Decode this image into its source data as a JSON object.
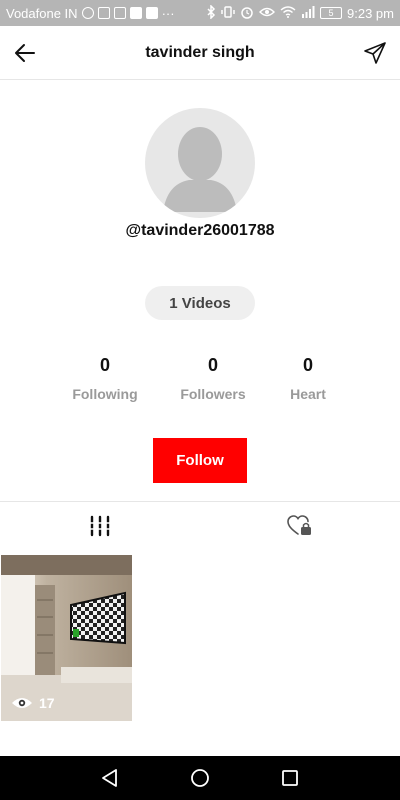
{
  "status_bar": {
    "carrier": "Vodafone IN",
    "overflow": "···",
    "battery_level": "5",
    "time": "9:23 pm",
    "icons": [
      "whatsapp-icon",
      "sim-icon",
      "app-icon",
      "app-icon",
      "facebook-icon",
      "bluetooth-icon",
      "vibrate-icon",
      "alarm-icon",
      "eye-icon",
      "wifi-icon",
      "signal-icon",
      "battery-icon"
    ]
  },
  "header": {
    "title": "tavinder singh",
    "back_icon": "back-arrow-icon",
    "share_icon": "send-icon"
  },
  "profile": {
    "username": "@tavinder26001788",
    "videos_label": "1 Videos",
    "stats": [
      {
        "value": "0",
        "label": "Following"
      },
      {
        "value": "0",
        "label": "Followers"
      },
      {
        "value": "0",
        "label": "Heart"
      }
    ],
    "follow_label": "Follow",
    "follow_color": "#ff0000"
  },
  "tabs": [
    {
      "icon": "grid-bars-icon",
      "active": true
    },
    {
      "icon": "liked-locked-icon",
      "active": false
    }
  ],
  "videos": [
    {
      "views": "17"
    }
  ]
}
